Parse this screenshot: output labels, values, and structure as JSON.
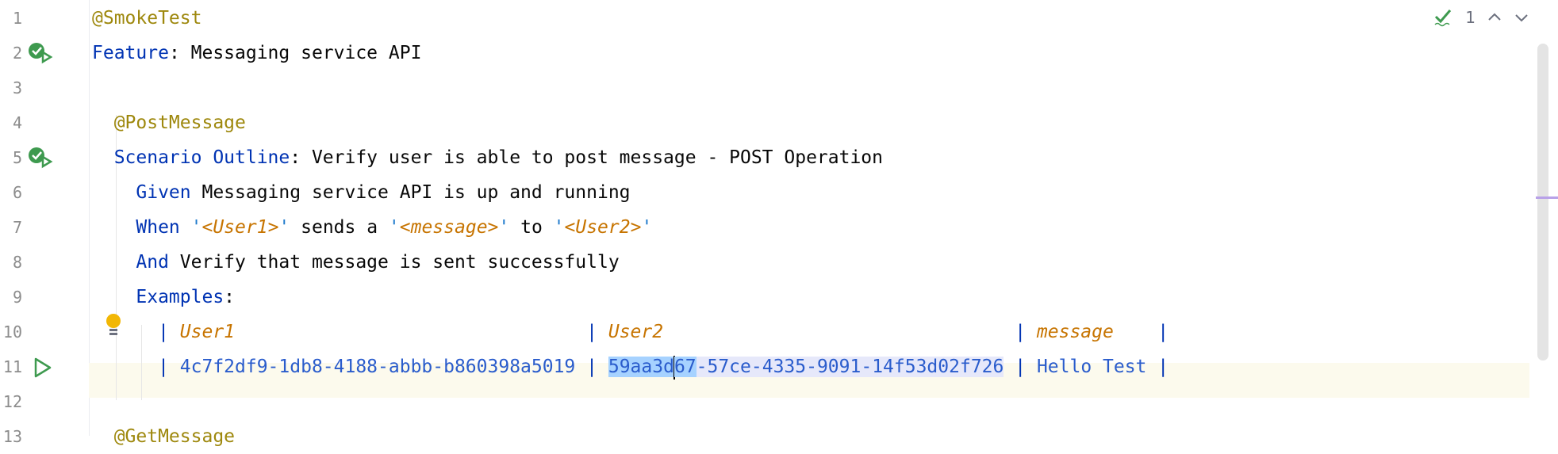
{
  "lines": [
    {
      "n": "1",
      "segments": [
        {
          "t": "@SmokeTest",
          "c": "tag"
        }
      ]
    },
    {
      "n": "2",
      "segments": [
        {
          "t": "Feature",
          "c": "kw"
        },
        {
          "t": ": Messaging service API",
          "c": ""
        }
      ]
    },
    {
      "n": "3",
      "segments": []
    },
    {
      "n": "4",
      "segments": [
        {
          "t": "  @PostMessage",
          "c": "tag"
        }
      ]
    },
    {
      "n": "5",
      "segments": [
        {
          "t": "  Scenario Outline",
          "c": "kw"
        },
        {
          "t": ": Verify user is able to post message - POST Operation",
          "c": ""
        }
      ]
    },
    {
      "n": "6",
      "segments": [
        {
          "t": "    Given",
          "c": "kw"
        },
        {
          "t": " Messaging service API is up and running",
          "c": ""
        }
      ]
    },
    {
      "n": "7",
      "segments": [
        {
          "t": "    When",
          "c": "kw"
        },
        {
          "t": " '",
          "c": "q"
        },
        {
          "t": "<User1>",
          "c": "param"
        },
        {
          "t": "'",
          "c": "q"
        },
        {
          "t": " sends a ",
          "c": ""
        },
        {
          "t": "'",
          "c": "q"
        },
        {
          "t": "<message>",
          "c": "param"
        },
        {
          "t": "'",
          "c": "q"
        },
        {
          "t": " to ",
          "c": ""
        },
        {
          "t": "'",
          "c": "q"
        },
        {
          "t": "<User2>",
          "c": "param"
        },
        {
          "t": "'",
          "c": "q"
        }
      ]
    },
    {
      "n": "8",
      "segments": [
        {
          "t": "    And",
          "c": "kw"
        },
        {
          "t": " Verify that message is sent successfully",
          "c": ""
        }
      ]
    },
    {
      "n": "9",
      "segments": [
        {
          "t": "    Examples",
          "c": "kw"
        },
        {
          "t": ":",
          "c": ""
        }
      ]
    },
    {
      "n": "10",
      "segments": [
        {
          "t": "      | ",
          "c": "pipe"
        },
        {
          "t": "User1                                ",
          "c": "hdr"
        },
        {
          "t": "| ",
          "c": "pipe"
        },
        {
          "t": "User2                                ",
          "c": "hdr"
        },
        {
          "t": "| ",
          "c": "pipe"
        },
        {
          "t": "message    ",
          "c": "hdr"
        },
        {
          "t": "|",
          "c": "pipe"
        }
      ]
    },
    {
      "n": "11",
      "segments": [
        {
          "t": "      | ",
          "c": "pipe"
        },
        {
          "t": "4c7f2df9-1db8-4188-abbb-b860398a5019 ",
          "c": "cell"
        },
        {
          "t": "| ",
          "c": "pipe"
        },
        {
          "t": "59aa3d",
          "c": "cell sel"
        },
        {
          "t": "CARET",
          "c": "caret"
        },
        {
          "t": "67",
          "c": "cell sel"
        },
        {
          "t": "-57ce-4335-9091-14f53d02f726",
          "c": "cell sel-soft"
        },
        {
          "t": " ",
          "c": ""
        },
        {
          "t": "| ",
          "c": "pipe"
        },
        {
          "t": "Hello Test ",
          "c": "cell"
        },
        {
          "t": "|",
          "c": "pipe"
        }
      ]
    },
    {
      "n": "12",
      "segments": []
    },
    {
      "n": "13",
      "segments": [
        {
          "t": "  @GetMessage",
          "c": "tag"
        }
      ]
    }
  ],
  "inspection": {
    "count": "1"
  },
  "colors": {
    "keyword": "#0033b3",
    "tag": "#9e880d",
    "param": "#c77400",
    "cell": "#2a5ccc",
    "selection": "#a6d2ff",
    "current_line": "#fcfaed"
  }
}
